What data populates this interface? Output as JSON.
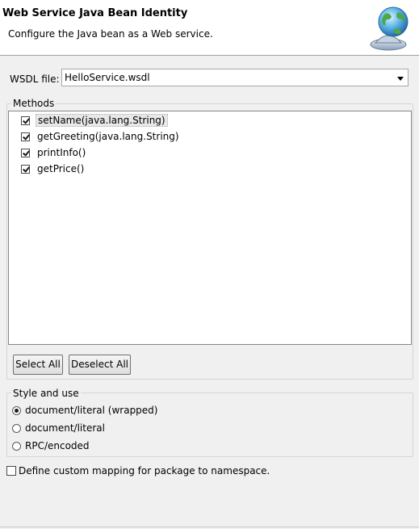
{
  "header": {
    "title": "Web Service Java Bean Identity",
    "description": "Configure the Java bean as a Web service.",
    "icon": "web-service-globe-icon"
  },
  "wsdl": {
    "label": "WSDL file:",
    "value": "HelloService.wsdl"
  },
  "methods": {
    "legend": "Methods",
    "items": [
      {
        "label": "setName(java.lang.String)",
        "checked": true
      },
      {
        "label": "getGreeting(java.lang.String)",
        "checked": true
      },
      {
        "label": "printInfo()",
        "checked": true
      },
      {
        "label": "getPrice()",
        "checked": true
      }
    ],
    "select_all": "Select All",
    "deselect_all": "Deselect All"
  },
  "style": {
    "legend": "Style and use",
    "options": [
      {
        "label": "document/literal (wrapped)",
        "selected": true
      },
      {
        "label": "document/literal",
        "selected": false
      },
      {
        "label": "RPC/encoded",
        "selected": false
      }
    ]
  },
  "custom_mapping": {
    "label": "Define custom mapping for package to namespace.",
    "checked": false
  }
}
